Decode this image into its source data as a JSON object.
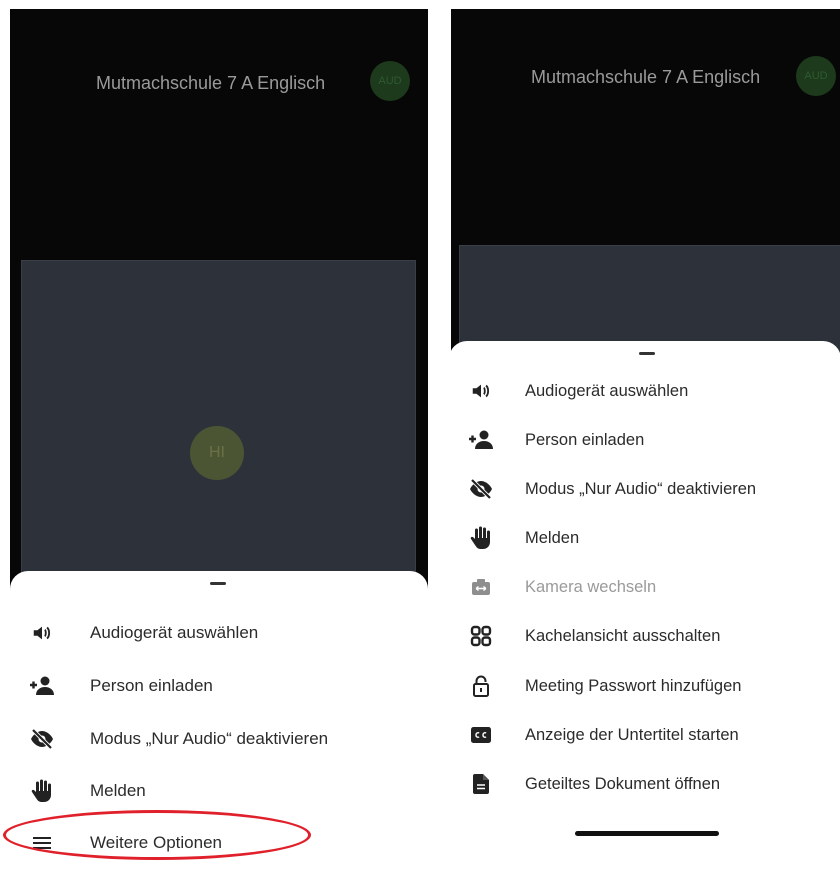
{
  "left_screen": {
    "meeting_title": "Mutmachschule 7 A Englisch",
    "top_avatar_initials": "AUD",
    "tile_avatar_initials": "HI",
    "menu": [
      {
        "label": "Audiogerät auswählen",
        "icon": "speaker-icon"
      },
      {
        "label": "Person einladen",
        "icon": "add-person-icon"
      },
      {
        "label": "Modus „Nur Audio“ deaktivieren",
        "icon": "eye-off-icon"
      },
      {
        "label": "Melden",
        "icon": "raise-hand-icon"
      },
      {
        "label": "Weitere Optionen",
        "icon": "menu-icon"
      }
    ]
  },
  "right_screen": {
    "meeting_title": "Mutmachschule 7 A Englisch",
    "top_avatar_initials": "AUD",
    "menu": [
      {
        "label": "Audiogerät auswählen",
        "icon": "speaker-icon"
      },
      {
        "label": "Person einladen",
        "icon": "add-person-icon"
      },
      {
        "label": "Modus „Nur Audio“ deaktivieren",
        "icon": "eye-off-icon"
      },
      {
        "label": "Melden",
        "icon": "raise-hand-icon"
      },
      {
        "label": "Kamera wechseln",
        "icon": "switch-camera-icon",
        "disabled": true
      },
      {
        "label": "Kachelansicht ausschalten",
        "icon": "tile-view-icon"
      },
      {
        "label": "Meeting Passwort hinzufügen",
        "icon": "lock-icon"
      },
      {
        "label": "Anzeige der Untertitel starten",
        "icon": "closed-captions-icon"
      },
      {
        "label": "Geteiltes Dokument öffnen",
        "icon": "document-icon"
      }
    ]
  },
  "colors": {
    "annotation": "#e0202a",
    "background_dark": "#070707",
    "tile": "#2d323a"
  }
}
